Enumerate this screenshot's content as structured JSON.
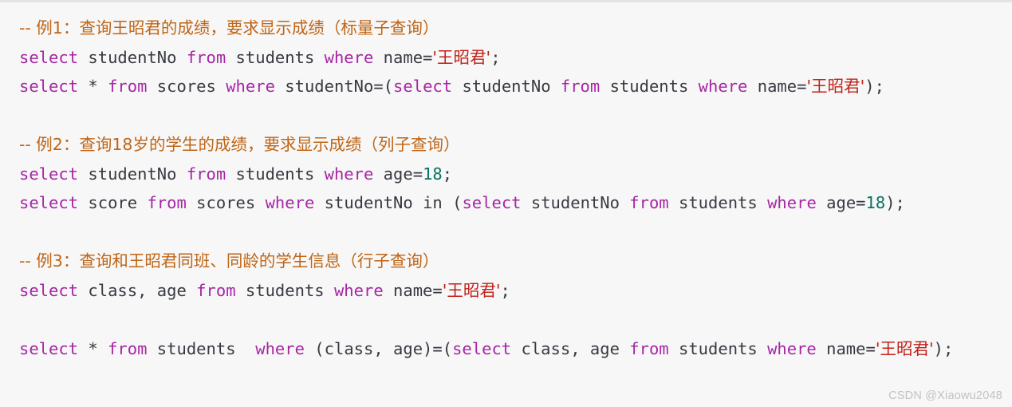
{
  "window": {
    "background_color": "#f7f7f7",
    "top_border_color": "#e3e3e3"
  },
  "theme": {
    "comment_color": "#bf6516",
    "keyword_color": "#a626a4",
    "identifier_color": "#383a42",
    "string_color": "#c0211a",
    "number_color": "#0b7261"
  },
  "watermark": {
    "text": "CSDN @Xiaowu2048"
  },
  "code": {
    "language": "sql",
    "lines": [
      {
        "id": "line-1",
        "kind": "comment",
        "text": "-- 例1：查询王昭君的成绩，要求显示成绩（标量子查询）",
        "tokens": [
          {
            "t": "comment",
            "v": "-- 例1：查询王昭君的成绩，要求显示成绩（标量子查询）"
          }
        ]
      },
      {
        "id": "line-2",
        "kind": "statement",
        "text": "select studentNo from students where name='王昭君';",
        "tokens": [
          {
            "t": "keyword",
            "v": "select"
          },
          {
            "t": "plain",
            "v": " studentNo "
          },
          {
            "t": "keyword",
            "v": "from"
          },
          {
            "t": "plain",
            "v": " students "
          },
          {
            "t": "keyword",
            "v": "where"
          },
          {
            "t": "plain",
            "v": " name="
          },
          {
            "t": "string",
            "v": "'王昭君'"
          },
          {
            "t": "punct",
            "v": ";"
          }
        ]
      },
      {
        "id": "line-3",
        "kind": "statement",
        "text": "select * from scores where studentNo=(select studentNo from students where name='王昭君');",
        "tokens": [
          {
            "t": "keyword",
            "v": "select"
          },
          {
            "t": "plain",
            "v": " * "
          },
          {
            "t": "keyword",
            "v": "from"
          },
          {
            "t": "plain",
            "v": " scores "
          },
          {
            "t": "keyword",
            "v": "where"
          },
          {
            "t": "plain",
            "v": " studentNo=("
          },
          {
            "t": "keyword",
            "v": "select"
          },
          {
            "t": "plain",
            "v": " studentNo "
          },
          {
            "t": "keyword",
            "v": "from"
          },
          {
            "t": "plain",
            "v": " students "
          },
          {
            "t": "keyword",
            "v": "where"
          },
          {
            "t": "plain",
            "v": " name="
          },
          {
            "t": "string",
            "v": "'王昭君'"
          },
          {
            "t": "punct",
            "v": ");"
          }
        ]
      },
      {
        "id": "line-4",
        "kind": "blank",
        "text": "",
        "tokens": []
      },
      {
        "id": "line-5",
        "kind": "comment",
        "text": "-- 例2：查询18岁的学生的成绩，要求显示成绩（列子查询）",
        "tokens": [
          {
            "t": "comment",
            "v": "-- 例2：查询18岁的学生的成绩，要求显示成绩（列子查询）"
          }
        ]
      },
      {
        "id": "line-6",
        "kind": "statement",
        "text": "select studentNo from students where age=18;",
        "tokens": [
          {
            "t": "keyword",
            "v": "select"
          },
          {
            "t": "plain",
            "v": " studentNo "
          },
          {
            "t": "keyword",
            "v": "from"
          },
          {
            "t": "plain",
            "v": " students "
          },
          {
            "t": "keyword",
            "v": "where"
          },
          {
            "t": "plain",
            "v": " age="
          },
          {
            "t": "number",
            "v": "18"
          },
          {
            "t": "punct",
            "v": ";"
          }
        ]
      },
      {
        "id": "line-7",
        "kind": "statement",
        "text": "select score from scores where studentNo in (select studentNo from students where age=18);",
        "tokens": [
          {
            "t": "keyword",
            "v": "select"
          },
          {
            "t": "plain",
            "v": " score "
          },
          {
            "t": "keyword",
            "v": "from"
          },
          {
            "t": "plain",
            "v": " scores "
          },
          {
            "t": "keyword",
            "v": "where"
          },
          {
            "t": "plain",
            "v": " studentNo in ("
          },
          {
            "t": "keyword",
            "v": "select"
          },
          {
            "t": "plain",
            "v": " studentNo "
          },
          {
            "t": "keyword",
            "v": "from"
          },
          {
            "t": "plain",
            "v": " students "
          },
          {
            "t": "keyword",
            "v": "where"
          },
          {
            "t": "plain",
            "v": " age="
          },
          {
            "t": "number",
            "v": "18"
          },
          {
            "t": "punct",
            "v": ");"
          }
        ]
      },
      {
        "id": "line-8",
        "kind": "blank",
        "text": "",
        "tokens": []
      },
      {
        "id": "line-9",
        "kind": "comment",
        "text": "-- 例3：查询和王昭君同班、同龄的学生信息（行子查询）",
        "tokens": [
          {
            "t": "comment",
            "v": "-- 例3：查询和王昭君同班、同龄的学生信息（行子查询）"
          }
        ]
      },
      {
        "id": "line-10",
        "kind": "statement",
        "text": "select class, age from students where name='王昭君';",
        "tokens": [
          {
            "t": "keyword",
            "v": "select"
          },
          {
            "t": "plain",
            "v": " class, age "
          },
          {
            "t": "keyword",
            "v": "from"
          },
          {
            "t": "plain",
            "v": " students "
          },
          {
            "t": "keyword",
            "v": "where"
          },
          {
            "t": "plain",
            "v": " name="
          },
          {
            "t": "string",
            "v": "'王昭君'"
          },
          {
            "t": "punct",
            "v": ";"
          }
        ]
      },
      {
        "id": "line-11",
        "kind": "blank",
        "text": "",
        "tokens": []
      },
      {
        "id": "line-12",
        "kind": "statement",
        "text": "select * from students  where (class, age)=(select class, age from students where name='王昭君');",
        "tokens": [
          {
            "t": "keyword",
            "v": "select"
          },
          {
            "t": "plain",
            "v": " * "
          },
          {
            "t": "keyword",
            "v": "from"
          },
          {
            "t": "plain",
            "v": " students  "
          },
          {
            "t": "keyword",
            "v": "where"
          },
          {
            "t": "plain",
            "v": " (class, age)=("
          },
          {
            "t": "keyword",
            "v": "select"
          },
          {
            "t": "plain",
            "v": " class, age "
          },
          {
            "t": "keyword",
            "v": "from"
          },
          {
            "t": "plain",
            "v": " students "
          },
          {
            "t": "keyword",
            "v": "where"
          },
          {
            "t": "plain",
            "v": " name="
          },
          {
            "t": "string",
            "v": "'王昭君'"
          },
          {
            "t": "punct",
            "v": ");"
          }
        ]
      }
    ]
  }
}
